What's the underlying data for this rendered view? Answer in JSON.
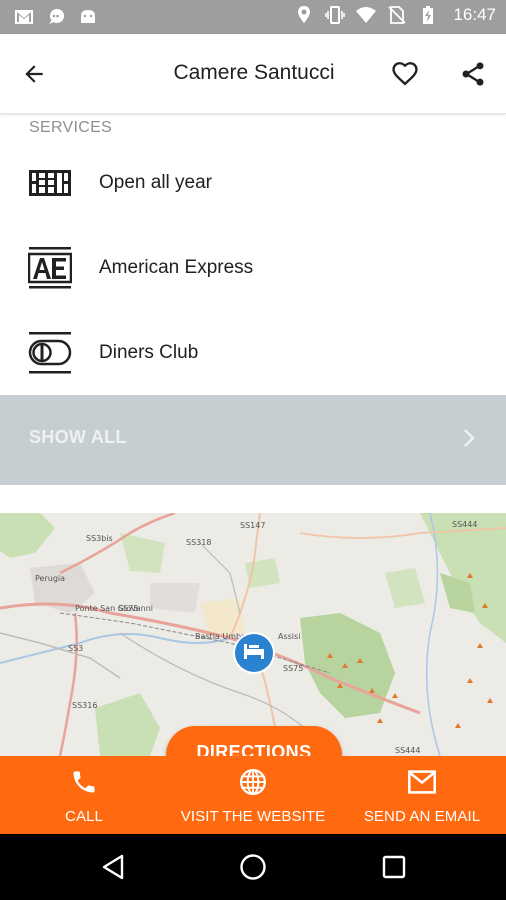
{
  "status_bar": {
    "time": "16:47",
    "left_icons": [
      "gmail-icon",
      "chat-icon",
      "android-icon"
    ],
    "right_icons": [
      "location-icon",
      "vibrate-icon",
      "wifi-icon",
      "no-sim-icon",
      "battery-charging-icon"
    ]
  },
  "app_bar": {
    "title": "Camere Santucci",
    "back_icon": "arrow-back-icon",
    "favorite_icon": "heart-outline-icon",
    "share_icon": "share-icon"
  },
  "services": {
    "header": "SERVICES",
    "items": [
      {
        "label": "Open all year",
        "icon": "calendar-grid-icon"
      },
      {
        "label": "American Express",
        "icon": "amex-icon"
      },
      {
        "label": "Diners Club",
        "icon": "diners-club-icon"
      }
    ],
    "show_all_label": "SHOW ALL"
  },
  "map": {
    "labels": [
      "Perugia",
      "Ponte San Giovanni",
      "Bastia Umbra",
      "Assisi",
      "SS318",
      "SS3bis",
      "SS75",
      "SS147",
      "SS444",
      "SS3",
      "SS316",
      "SS444",
      "SS75"
    ],
    "marker_icon": "hotel-bed-icon"
  },
  "directions_label": "DIRECTIONS",
  "actions": [
    {
      "label": "CALL",
      "icon": "phone-icon"
    },
    {
      "label": "VISIT THE WEBSITE",
      "icon": "globe-icon"
    },
    {
      "label": "SEND AN EMAIL",
      "icon": "mail-icon"
    }
  ],
  "colors": {
    "accent": "#ff6a10",
    "status_bar": "#9e9e9e",
    "show_all_bg": "#c7ced1"
  }
}
